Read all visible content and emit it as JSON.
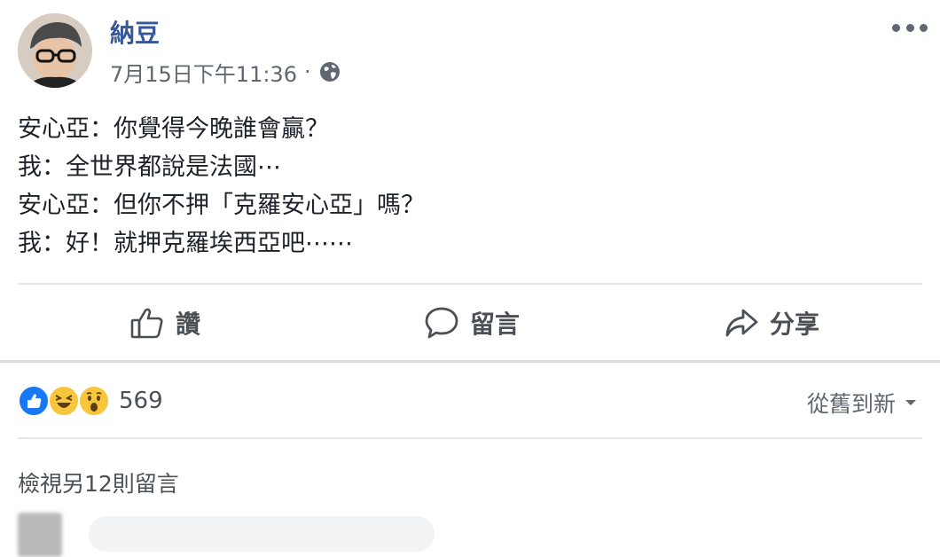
{
  "post": {
    "author": "納豆",
    "timestamp": "7月15日下午11:36",
    "separator": "·",
    "privacy_icon": "globe-icon",
    "more_icon": "more-options-icon",
    "lines": [
      "安心亞：你覺得今晚誰會贏？",
      "我：全世界都說是法國⋯",
      "安心亞：但你不押「克羅安心亞」嗎？",
      "我：好！就押克羅埃西亞吧⋯⋯"
    ]
  },
  "actions": {
    "like": "讚",
    "comment": "留言",
    "share": "分享"
  },
  "reactions": {
    "icons": [
      "like-icon",
      "haha-icon",
      "wow-icon"
    ],
    "count": "569"
  },
  "comments": {
    "sort_label": "從舊到新",
    "view_more": "檢視另12則留言"
  },
  "colors": {
    "name": "#365899",
    "like_blue": "#1877f2",
    "emoji_yellow": "#f7c63d",
    "text": "#1d2129",
    "secondary": "#606770"
  }
}
